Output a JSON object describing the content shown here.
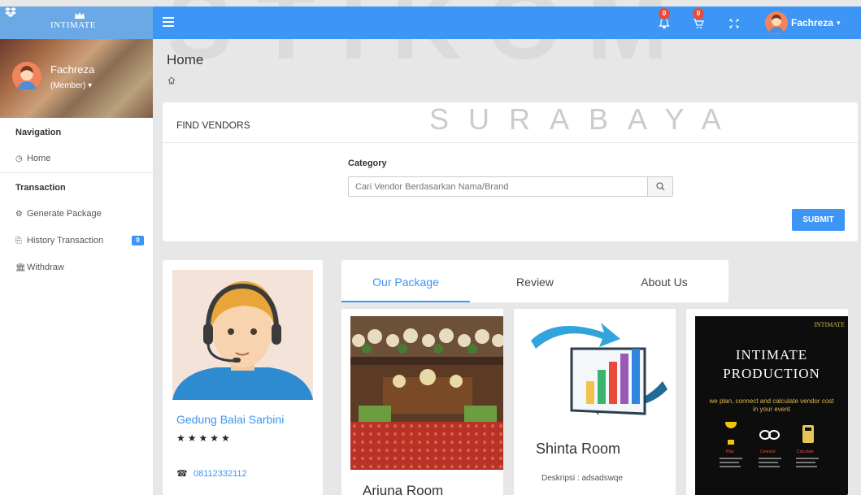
{
  "brand": {
    "logo_text": "INTIMATE"
  },
  "topbar": {
    "notif_count": "0",
    "cart_count": "0",
    "user_name": "Fachreza",
    "user_chevron": "⌄"
  },
  "watermark": {
    "big": "STIKOM",
    "sub": "SURABAYA"
  },
  "sidebar": {
    "profile": {
      "name": "Fachreza",
      "role": "(Member)"
    },
    "nav_head": "Navigation",
    "home": "Home",
    "trans_head": "Transaction",
    "generate": "Generate Package",
    "history": "History Transaction",
    "history_badge": "0",
    "withdraw": "Withdraw"
  },
  "page": {
    "title": "Home"
  },
  "find_vendors": {
    "title": "FIND VENDORS",
    "category_label": "Category",
    "search_placeholder": "Cari Vendor Berdasarkan Nama/Brand",
    "submit": "SUBMIT"
  },
  "vendor": {
    "name": "Gedung Balai Sarbini",
    "stars": "★★★★★",
    "rating": 5,
    "phone": "08112332112"
  },
  "tabs": [
    "Our Package",
    "Review",
    "About Us"
  ],
  "packages": [
    {
      "title": "Arjuna Room",
      "desc": ""
    },
    {
      "title": "Shinta Room",
      "desc": "Deskripsi : adsadswqe"
    },
    {
      "title": "",
      "desc": "",
      "logo_title_1": "INTIMATE",
      "logo_title_2": "PRODUCTION",
      "tagline": "we plan, connect and calculate vendor cost in your event",
      "steps": [
        "Plan",
        "Connect",
        "Calculate"
      ]
    }
  ],
  "colors": {
    "primary": "#3d95f5",
    "badge": "#e74c3c"
  },
  "icons": [
    "dropbox-icon",
    "hamburger-icon",
    "bell-icon",
    "cart-icon",
    "fullscreen-icon",
    "home-icon",
    "refresh-icon",
    "gears-icon",
    "history-icon",
    "bank-icon",
    "search-icon",
    "phone-icon"
  ]
}
